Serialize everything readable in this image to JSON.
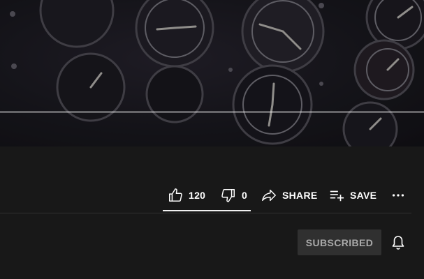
{
  "video": {
    "progress_fraction": 1.0,
    "thumbnail_subject": "aircraft-cockpit-gauges"
  },
  "actions": {
    "like_count": "120",
    "dislike_count": "0",
    "share_label": "SHARE",
    "save_label": "SAVE",
    "more_icon": "more-horiz-icon"
  },
  "channel": {
    "subscribe_label": "SUBSCRIBED",
    "notification_icon": "bell-icon"
  },
  "colors": {
    "background": "#181818",
    "text": "#ffffff",
    "muted_text": "#aaaaaa",
    "button_bg": "#303030"
  }
}
